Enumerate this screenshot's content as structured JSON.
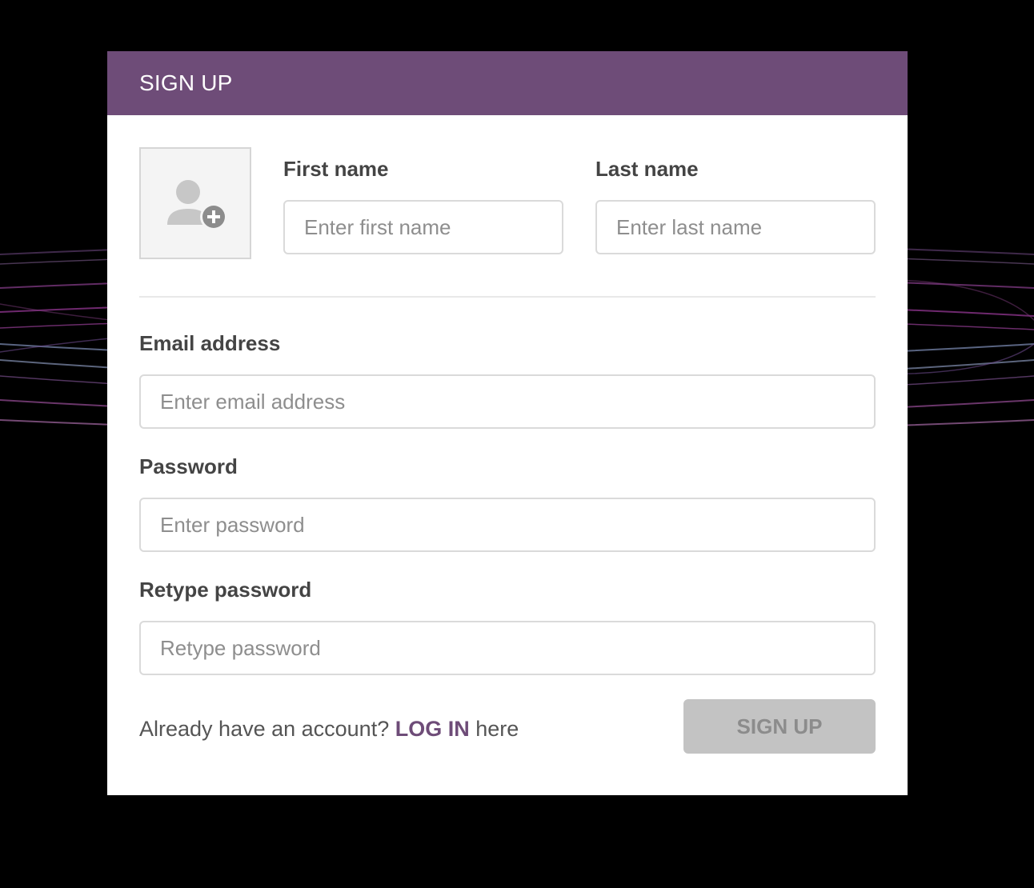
{
  "header": {
    "title": "SIGN UP"
  },
  "avatar": {
    "icon": "add-user-icon"
  },
  "form": {
    "first_name": {
      "label": "First name",
      "placeholder": "Enter first name"
    },
    "last_name": {
      "label": "Last name",
      "placeholder": "Enter last name"
    },
    "email": {
      "label": "Email address",
      "placeholder": "Enter email address"
    },
    "password": {
      "label": "Password",
      "placeholder": "Enter password"
    },
    "retype_password": {
      "label": "Retype password",
      "placeholder": "Retype password"
    }
  },
  "footer": {
    "prefix": "Already have an account? ",
    "login_link": "LOG IN",
    "suffix": " here",
    "submit_label": "SIGN UP"
  },
  "colors": {
    "accent": "#6e4c78",
    "button_disabled": "#c3c3c3",
    "background": "#000000"
  }
}
